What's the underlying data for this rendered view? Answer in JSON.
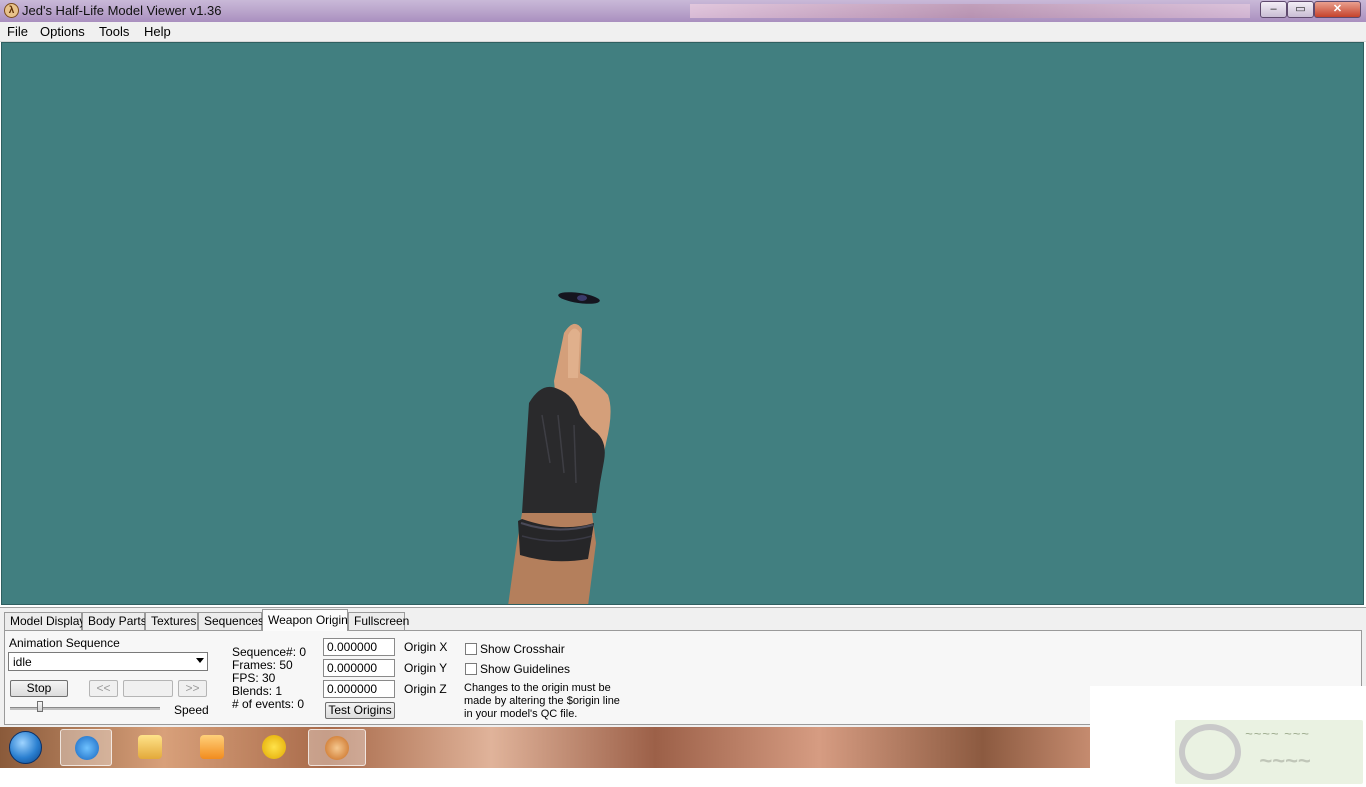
{
  "window": {
    "title": "Jed's Half-Life Model Viewer v1.36"
  },
  "menu": [
    "File",
    "Options",
    "Tools",
    "Help"
  ],
  "tabs": [
    "Model Display",
    "Body Parts",
    "Textures",
    "Sequences",
    "Weapon Origin",
    "Fullscreen"
  ],
  "active_tab": "Weapon Origin",
  "viewport": {
    "background": "#417f80"
  },
  "animation": {
    "label": "Animation Sequence",
    "selected": "idle",
    "stop_label": "Stop",
    "prev_label": "<<",
    "next_label": ">>",
    "speed_label": "Speed",
    "speed_level": 0.2
  },
  "info": {
    "sequence": "Sequence#: 0",
    "frames": "Frames: 50",
    "fps": "FPS: 30",
    "blends": "Blends: 1",
    "events": "# of events: 0"
  },
  "origin": {
    "x_value": "0.000000",
    "y_value": "0.000000",
    "z_value": "0.000000",
    "x_label": "Origin X",
    "y_label": "Origin Y",
    "z_label": "Origin Z",
    "test_label": "Test Origins"
  },
  "options": {
    "crosshair_label": "Show Crosshair",
    "guidelines_label": "Show Guidelines",
    "note_line1": "Changes to the origin must be",
    "note_line2": "made by altering the $origin line",
    "note_line3": "in your model's QC file."
  },
  "taskbar": {
    "items": [
      "windows-start",
      "internet-explorer-icon",
      "file-explorer-icon",
      "media-player-icon",
      "yahoo-messenger-icon",
      "half-life-model-viewer-icon"
    ]
  }
}
